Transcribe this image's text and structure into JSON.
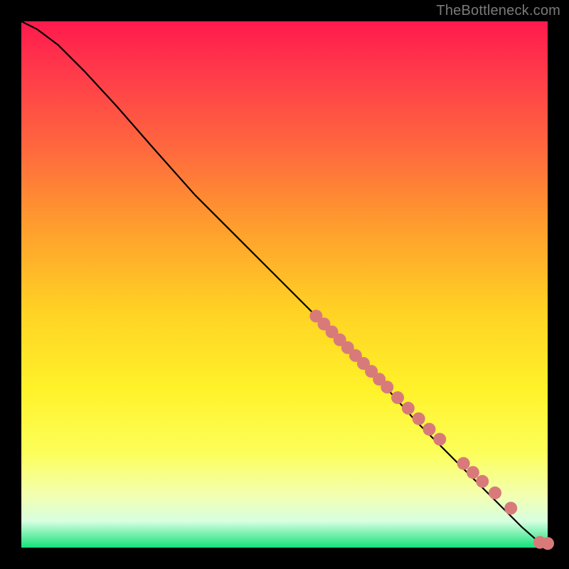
{
  "attribution": "TheBottleneck.com",
  "chart_data": {
    "type": "line",
    "title": "",
    "xlabel": "",
    "ylabel": "",
    "xlim": [
      0,
      1
    ],
    "ylim": [
      0,
      1
    ],
    "series": [
      {
        "name": "curve",
        "x": [
          0.0,
          0.03,
          0.07,
          0.12,
          0.18,
          0.25,
          0.33,
          0.42,
          0.5,
          0.58,
          0.67,
          0.75,
          0.83,
          0.9,
          0.95,
          0.975,
          0.99,
          1.0
        ],
        "y": [
          1.0,
          0.985,
          0.955,
          0.905,
          0.84,
          0.76,
          0.67,
          0.58,
          0.5,
          0.42,
          0.33,
          0.24,
          0.16,
          0.09,
          0.04,
          0.018,
          0.008,
          0.005
        ]
      }
    ],
    "markers": [
      {
        "x": 0.56,
        "y": 0.44
      },
      {
        "x": 0.575,
        "y": 0.425
      },
      {
        "x": 0.59,
        "y": 0.41
      },
      {
        "x": 0.605,
        "y": 0.395
      },
      {
        "x": 0.62,
        "y": 0.38
      },
      {
        "x": 0.635,
        "y": 0.365
      },
      {
        "x": 0.65,
        "y": 0.35
      },
      {
        "x": 0.665,
        "y": 0.335
      },
      {
        "x": 0.68,
        "y": 0.32
      },
      {
        "x": 0.695,
        "y": 0.305
      },
      {
        "x": 0.715,
        "y": 0.285
      },
      {
        "x": 0.735,
        "y": 0.265
      },
      {
        "x": 0.755,
        "y": 0.245
      },
      {
        "x": 0.775,
        "y": 0.225
      },
      {
        "x": 0.795,
        "y": 0.206
      },
      {
        "x": 0.84,
        "y": 0.16
      },
      {
        "x": 0.858,
        "y": 0.143
      },
      {
        "x": 0.876,
        "y": 0.126
      },
      {
        "x": 0.9,
        "y": 0.104
      },
      {
        "x": 0.93,
        "y": 0.075
      },
      {
        "x": 0.985,
        "y": 0.01
      },
      {
        "x": 1.0,
        "y": 0.008
      }
    ],
    "marker_radius_px": 9,
    "background_gradient": {
      "direction": "vertical",
      "stops": [
        {
          "pos": 0.0,
          "color": "#ff1a4d"
        },
        {
          "pos": 0.55,
          "color": "#ffd224"
        },
        {
          "pos": 0.82,
          "color": "#fcff5a"
        },
        {
          "pos": 1.0,
          "color": "#14e07a"
        }
      ]
    }
  }
}
